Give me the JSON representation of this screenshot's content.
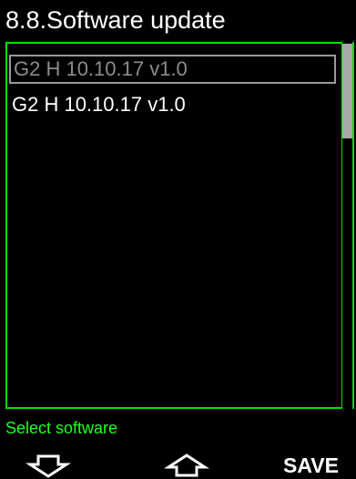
{
  "header": {
    "title": "8.8.Software update"
  },
  "list": {
    "items": [
      {
        "label": "G2 H 10.10.17 v1.0",
        "selected": true
      },
      {
        "label": "G2 H 10.10.17 v1.0",
        "selected": false
      }
    ],
    "scroll_fraction": 0.26
  },
  "status": {
    "text": "Select software"
  },
  "softkeys": {
    "left_icon": "arrow-down-icon",
    "middle_icon": "arrow-up-icon",
    "right_label": "SAVE"
  },
  "colors": {
    "background": "#000000",
    "frame": "#00e000",
    "status_text": "#20ff20",
    "selected_text": "#8c8c8c",
    "text": "#ffffff"
  }
}
